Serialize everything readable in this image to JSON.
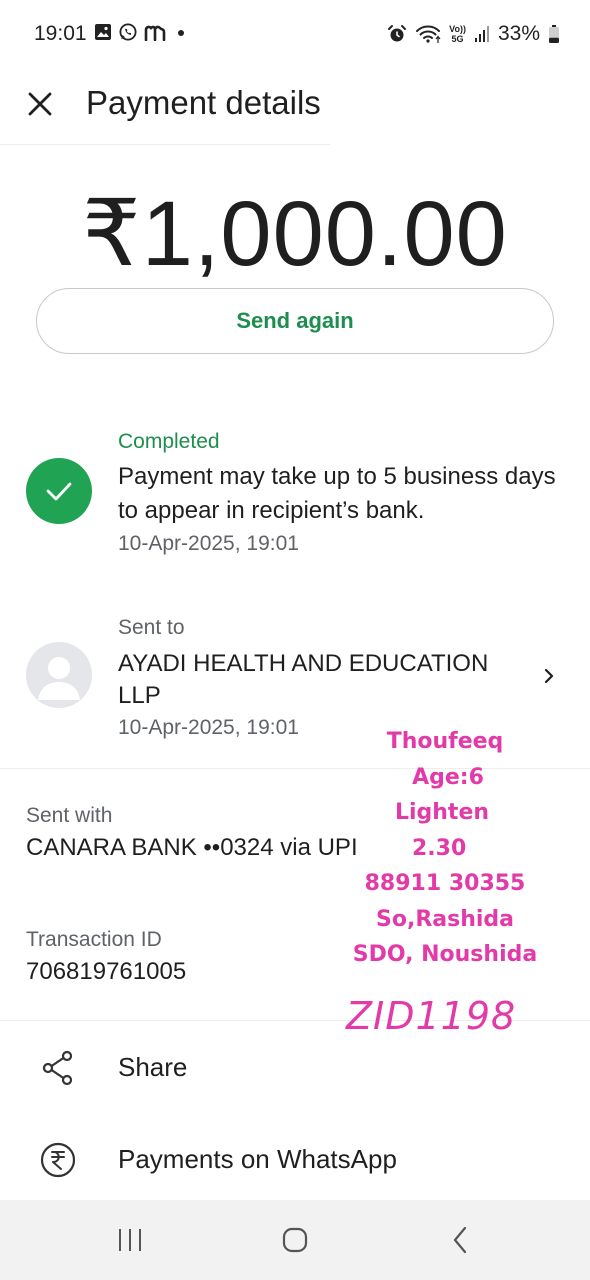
{
  "status_bar": {
    "time": "19:01",
    "left_icons": [
      "gallery-icon",
      "whatsapp-icon",
      "m-app-icon",
      "dot-icon"
    ],
    "right_icons": [
      "alarm-icon",
      "wifi-icon",
      "volte-5g-icon",
      "signal-icon",
      "battery-icon"
    ],
    "network_top": "Vo))",
    "network_bottom": "5G",
    "battery": "33%"
  },
  "header": {
    "title": "Payment details"
  },
  "amount": "₹1,000.00",
  "send_again_label": "Send again",
  "status": {
    "label": "Completed",
    "message": "Payment may take up to 5 business days to appear in recipient’s bank.",
    "timestamp": "10-Apr-2025, 19:01"
  },
  "recipient": {
    "label": "Sent to",
    "name": "AYADI HEALTH AND EDUCATION LLP",
    "timestamp": "10-Apr-2025, 19:01"
  },
  "sent_with": {
    "label": "Sent with",
    "value": "CANARA BANK ••0324 via UPI"
  },
  "transaction": {
    "label": "Transaction ID",
    "value": "706819761005"
  },
  "actions": {
    "share": "Share",
    "payments_whatsapp": "Payments on WhatsApp"
  },
  "handwritten_note": {
    "lines": [
      "Thoufeeq",
      "Age:6",
      "Lighten",
      "2.30",
      "88911 30355",
      "So,Rashida",
      "SDO, Noushida"
    ],
    "code": "ZID1198"
  },
  "colors": {
    "accent_green": "#1e8e4e",
    "check_green": "#20a353",
    "note_pink": "#e23aa8"
  }
}
